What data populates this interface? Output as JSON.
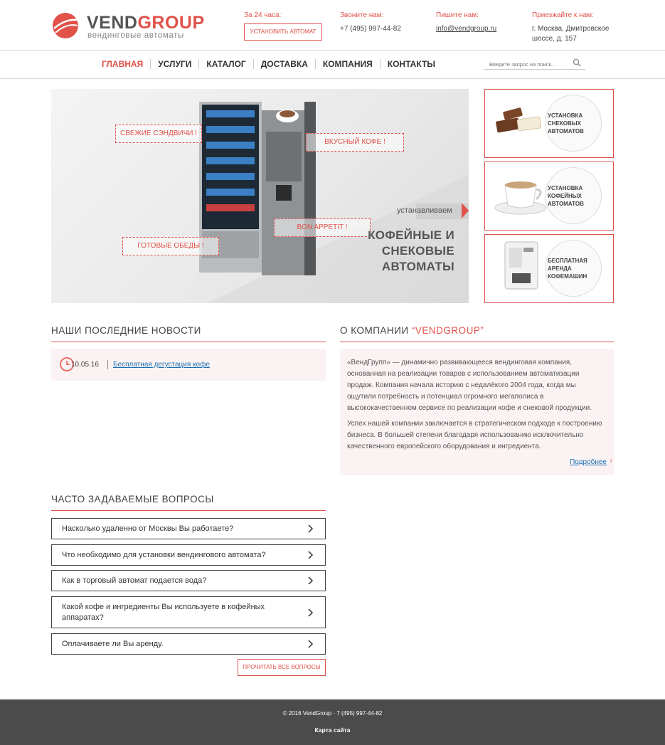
{
  "header": {
    "logo_part1": "VEND",
    "logo_part2": "GROUP",
    "logo_sub": "вендинговые автоматы",
    "col1_label": "За 24 часа:",
    "col1_button": "УСТАНОВИТЬ АВТОМАТ",
    "col2_label": "Звоните нам:",
    "col2_value": "+7 (495) 997-44-82",
    "col3_label": "Пишите нам:",
    "col3_value": "info@vendgroup.ru",
    "col4_label": "Приезжайте к нам:",
    "col4_line1": "г. Москва, Дмитровское",
    "col4_line2": "шоссе, д. 157"
  },
  "nav": {
    "items": [
      "ГЛАВНАЯ",
      "УСЛУГИ",
      "КАТАЛОГ",
      "ДОСТАВКА",
      "КОМПАНИЯ",
      "КОНТАКТЫ"
    ],
    "search_placeholder": "Введите запрос на поиск..."
  },
  "hero": {
    "tag1": "СВЕЖИЕ СЭНДВИЧИ !",
    "tag2": "ВКУСНЫЙ КОФЕ !",
    "tag3": "BON APPETIT !",
    "tag4": "ГОТОВЫЕ ОБЕДЫ !",
    "subtitle": "устанавливаем",
    "title_line1": "КОФЕЙНЫЕ И",
    "title_line2": "СНЕКОВЫЕ",
    "title_line3": "АВТОМАТЫ"
  },
  "side_cards": [
    {
      "label": "УСТАНОВКА СНЕКОВЫХ АВТОМАТОВ"
    },
    {
      "label": "УСТАНОВКА КОФЕЙНЫХ АВТОМАТОВ"
    },
    {
      "label": "БЕСПЛАТНАЯ АРЕНДА КОФЕМАШИН"
    }
  ],
  "news": {
    "title": "НАШИ ПОСЛЕДНИЕ НОВОСТИ",
    "date": "10.05.16",
    "link": "Бесплатная дегустация кофе"
  },
  "about": {
    "title_main": "О КОМПАНИИ ",
    "title_hl": "“VENDGROUP”",
    "p1": "«ВендГрупп» — динамично развивающееся вендинговая компания, основанная на реализации товаров с использованием автоматизации продаж. Компания начала историю с недалёкого 2004 года, когда мы ощутили потребность и потенциал огромного мегаполиса в высококачественном сервисе по реализации кофе и снековой продукции.",
    "p2": "Успех нашей компании заключается в стратегическом подходе к построению бизнеса. В большей степени благодаря использованию исключительно качественного европейского оборудования и ингредиента.",
    "more": "Подробнее"
  },
  "faq": {
    "title": "ЧАСТО ЗАДАВАЕМЫЕ ВОПРОСЫ",
    "items": [
      "Насколько удаленно от Москвы Вы работаете?",
      "Что необходимо для установки вендингового автомата?",
      "Как в торговый автомат подается вода?",
      "Какой кофе и ингредиенты Вы используете в кофейных аппаратах?",
      "Оплачиваете ли Вы аренду."
    ],
    "button": "ПРОЧИТАТЬ ВСЕ ВОПРОСЫ"
  },
  "footer": {
    "copyright": "© 2016 VendGroup · 7 (495) 997-44-82",
    "sitemap": "Карта сайта"
  },
  "colors": {
    "accent": "#e0524a",
    "link": "#1a6fb5",
    "footer_bg": "#4b4b4b"
  }
}
